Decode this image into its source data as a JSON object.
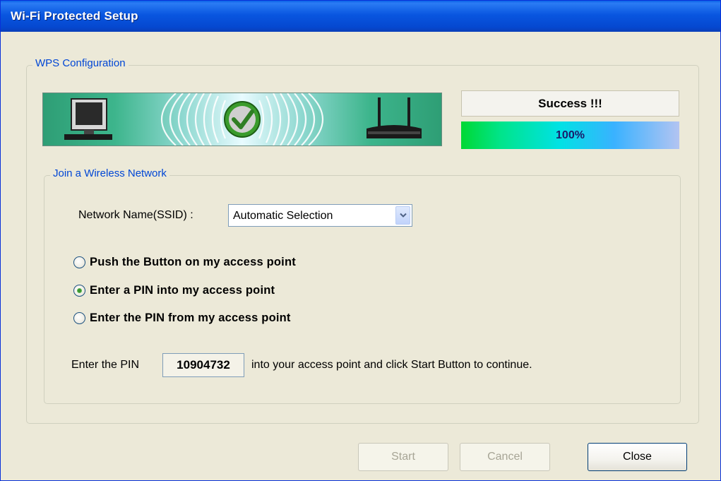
{
  "window": {
    "title": "Wi-Fi Protected Setup"
  },
  "wps_group": {
    "legend": "WPS Configuration"
  },
  "status": {
    "text": "Success !!!",
    "progress_percent": 100,
    "progress_label": "100%"
  },
  "join_group": {
    "legend": "Join a Wireless Network",
    "ssid_label": "Network Name(SSID) :",
    "ssid_value": "Automatic Selection",
    "options": [
      {
        "label": "Push the Button on my access point",
        "checked": false
      },
      {
        "label": "Enter a PIN into my access point",
        "checked": true
      },
      {
        "label": "Enter the PIN from my access point",
        "checked": false
      }
    ],
    "pin_prefix": "Enter the PIN",
    "pin_value": "10904732",
    "pin_suffix": "into your access point and click Start Button to continue."
  },
  "buttons": {
    "start": "Start",
    "cancel": "Cancel",
    "close": "Close"
  },
  "icons": {
    "computer": "computer-icon",
    "check": "check-icon",
    "router": "router-icon",
    "dropdown": "chevron-down-icon"
  },
  "colors": {
    "titlebar": "#0548d0",
    "legend": "#0046d5",
    "check": "#3a9b2c"
  }
}
